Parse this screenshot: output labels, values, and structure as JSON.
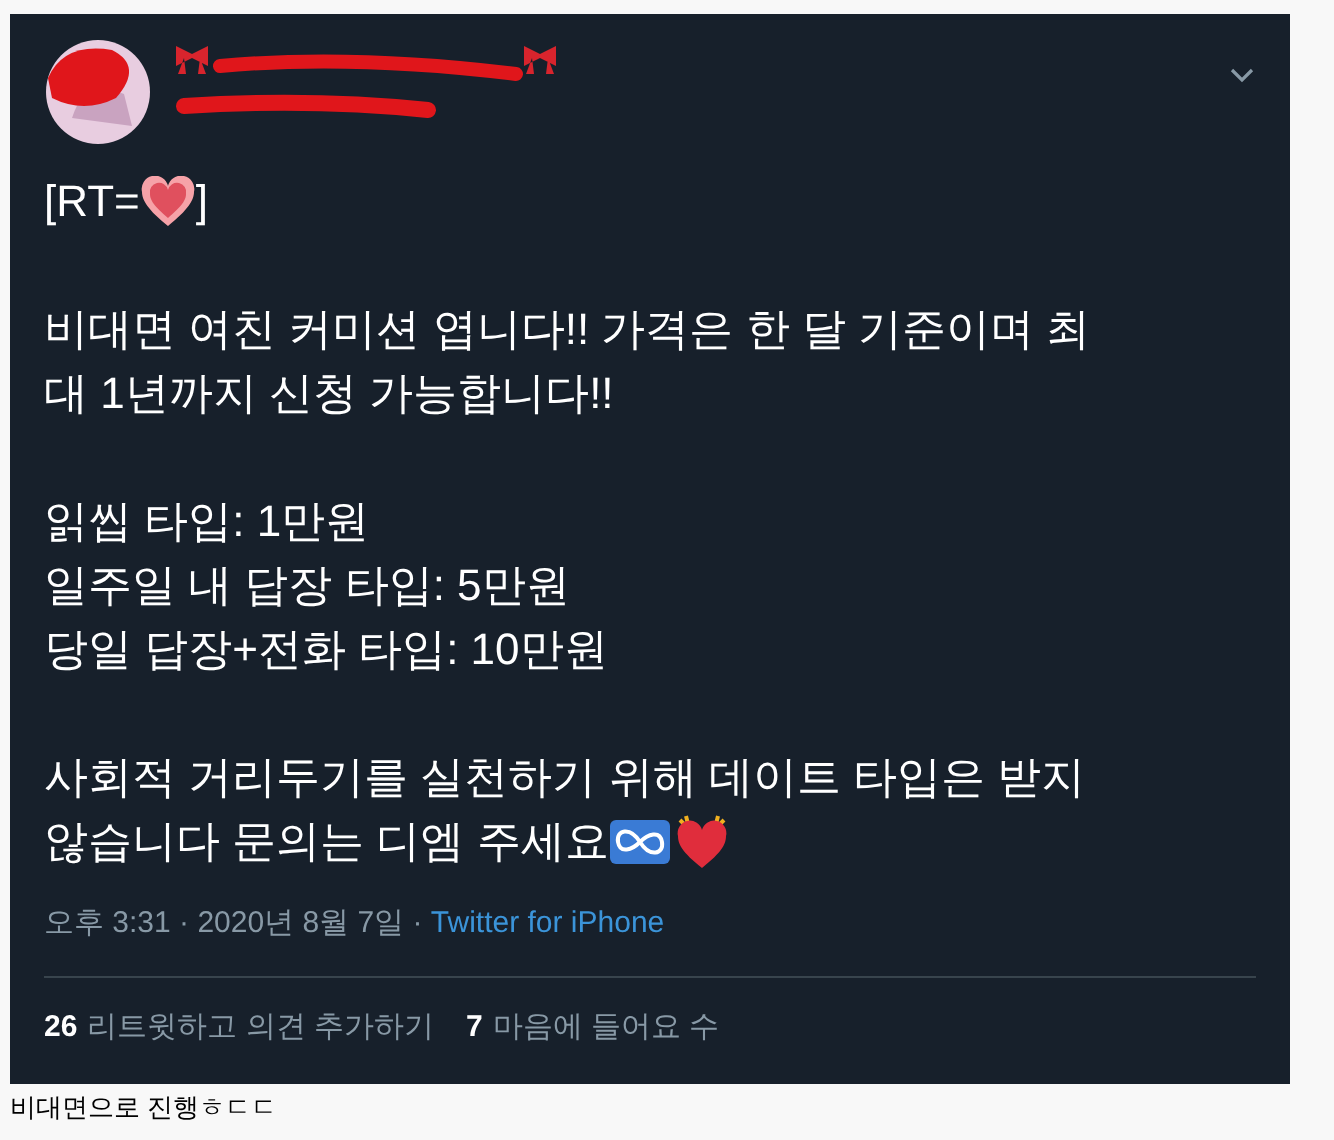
{
  "tweet": {
    "rt_line": {
      "before": "[RT=",
      "after": "]"
    },
    "paragraphs": [
      {
        "lines": [
          "비대면 여친 커미션 엽니다!! 가격은 한 달 기준이며 최",
          "대 1년까지 신청 가능합니다!!"
        ]
      },
      {
        "lines": [
          "읽씹 타입: 1만원",
          "일주일 내 답장 타입: 5만원",
          "당일 답장+전화 타입: 10만원"
        ]
      },
      {
        "lines": [
          "사회적 거리두기를 실천하기 위해 데이트 타입은 받지",
          "않습니다 문의는 디엠 주세요"
        ]
      }
    ],
    "time": "오후 3:31 · 2020년 8월 7일 · ",
    "source": "Twitter for iPhone",
    "stats": [
      {
        "count": "26",
        "label": "리트윗하고 의견 추가하기"
      },
      {
        "count": "7",
        "label": "마음에 들어요 수"
      }
    ]
  },
  "caption": "비대면으로 진행ㅎㄷㄷ"
}
